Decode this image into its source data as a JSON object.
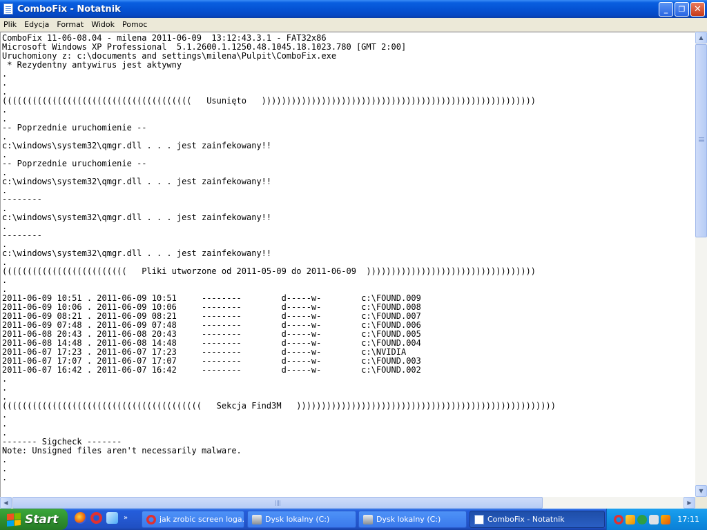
{
  "window": {
    "title": "ComboFix - Notatnik",
    "buttons": {
      "minimize": "_",
      "maximize": "❐",
      "close": "✕"
    }
  },
  "menu": [
    "Plik",
    "Edycja",
    "Format",
    "Widok",
    "Pomoc"
  ],
  "editor": {
    "lines": [
      "ComboFix 11-06-08.04 - milena 2011-06-09  13:12:43.3.1 - FAT32x86",
      "Microsoft Windows XP Professional  5.1.2600.1.1250.48.1045.18.1023.780 [GMT 2:00]",
      "Uruchomiony z: c:\\documents and settings\\milena\\Pulpit\\ComboFix.exe",
      " * Rezydentny antywirus jest aktywny",
      ".",
      ".",
      ".",
      "((((((((((((((((((((((((((((((((((((((   Usunięto   )))))))))))))))))))))))))))))))))))))))))))))))))))))))",
      ".",
      ".",
      "-- Poprzednie uruchomienie --",
      ".",
      "c:\\windows\\system32\\qmgr.dll . . . jest zainfekowany!!",
      ".",
      "-- Poprzednie uruchomienie --",
      ".",
      "c:\\windows\\system32\\qmgr.dll . . . jest zainfekowany!!",
      ".",
      "--------",
      ".",
      "c:\\windows\\system32\\qmgr.dll . . . jest zainfekowany!!",
      ".",
      "--------",
      ".",
      "c:\\windows\\system32\\qmgr.dll . . . jest zainfekowany!!",
      ".",
      "(((((((((((((((((((((((((   Pliki utworzone od 2011-05-09 do 2011-06-09  ))))))))))))))))))))))))))))))))))",
      ".",
      ".",
      "2011-06-09 10:51 . 2011-06-09 10:51\t--------\td-----w-\tc:\\FOUND.009",
      "2011-06-09 10:06 . 2011-06-09 10:06\t--------\td-----w-\tc:\\FOUND.008",
      "2011-06-09 08:21 . 2011-06-09 08:21\t--------\td-----w-\tc:\\FOUND.007",
      "2011-06-09 07:48 . 2011-06-09 07:48\t--------\td-----w-\tc:\\FOUND.006",
      "2011-06-08 20:43 . 2011-06-08 20:43\t--------\td-----w-\tc:\\FOUND.005",
      "2011-06-08 14:48 . 2011-06-08 14:48\t--------\td-----w-\tc:\\FOUND.004",
      "2011-06-07 17:23 . 2011-06-07 17:23\t--------\td-----w-\tc:\\NVIDIA",
      "2011-06-07 17:07 . 2011-06-07 17:07\t--------\td-----w-\tc:\\FOUND.003",
      "2011-06-07 16:42 . 2011-06-07 16:42\t--------\td-----w-\tc:\\FOUND.002",
      ".",
      ".",
      ".",
      "((((((((((((((((((((((((((((((((((((((((   Sekcja Find3M   ))))))))))))))))))))))))))))))))))))))))))))))))))))",
      ".",
      ".",
      ".",
      "------- Sigcheck -------",
      "Note: Unsigned files aren't necessarily malware.",
      ".",
      ".",
      "."
    ]
  },
  "taskbar": {
    "start_label": "Start",
    "tasks": [
      {
        "label": "jak zrobic screen loga...",
        "icon": "opera-icon",
        "active": false
      },
      {
        "label": "Dysk lokalny (C:)",
        "icon": "drive-icon",
        "active": false
      },
      {
        "label": "Dysk lokalny (C:)",
        "icon": "drive-icon",
        "active": false
      },
      {
        "label": "ComboFix - Notatnik",
        "icon": "notepad-icon",
        "active": true
      }
    ],
    "clock": "17:11"
  },
  "colors": {
    "titlebar": "#0553d4",
    "taskbar": "#245ddb",
    "start": "#2d8b2d",
    "tray": "#1090e3"
  }
}
